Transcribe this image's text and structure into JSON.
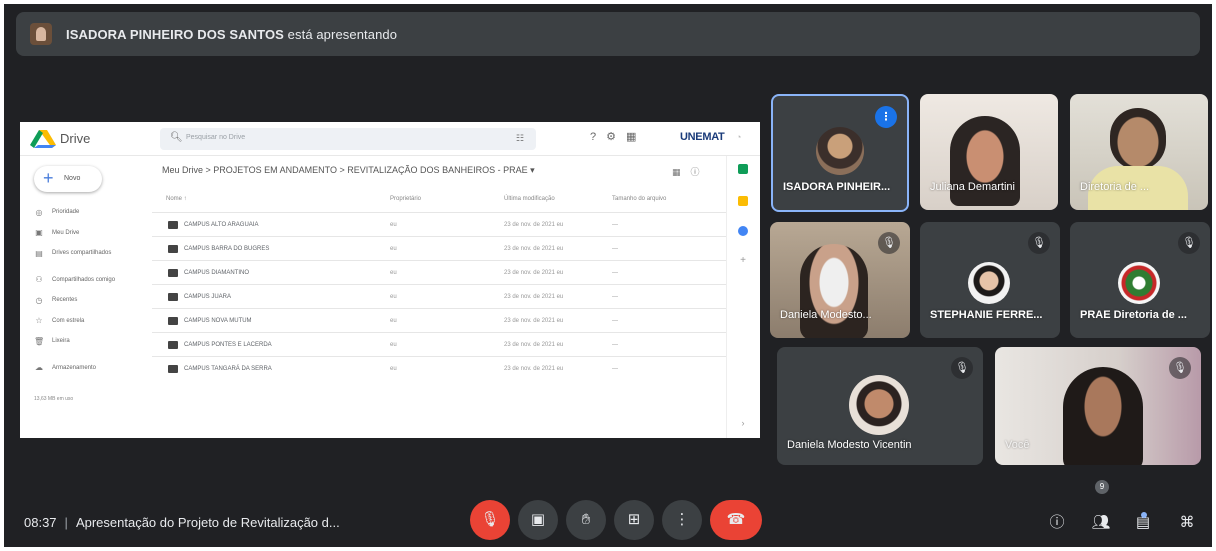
{
  "banner": {
    "presenter": "ISADORA PINHEIRO DOS SANTOS",
    "suffix": "está apresentando"
  },
  "drive": {
    "title": "Drive",
    "search_placeholder": "Pesquisar no Drive",
    "brand": "UNEMAT",
    "new_label": "Novo",
    "breadcrumb": "Meu Drive  >  PROJETOS EM ANDAMENTO  >  REVITALIZAÇÃO DOS BANHEIROS - PRAE  ▾",
    "nav": [
      {
        "icon": "◎",
        "label": "Prioridade"
      },
      {
        "icon": "▣",
        "label": "Meu Drive"
      },
      {
        "icon": "▤",
        "label": "Drives compartilhados"
      },
      {
        "icon": "⚇",
        "label": "Compartilhados comigo"
      },
      {
        "icon": "◷",
        "label": "Recentes"
      },
      {
        "icon": "☆",
        "label": "Com estrela"
      },
      {
        "icon": "🗑",
        "label": "Lixeira"
      },
      {
        "icon": "☁",
        "label": "Armazenamento"
      }
    ],
    "storage_used": "13,63 MB em uso",
    "columns": {
      "name": "Nome ↑",
      "owner": "Proprietário",
      "modified": "Última modificação",
      "size": "Tamanho do arquivo"
    },
    "files": [
      {
        "name": "CAMPUS ALTO ARAGUAIA",
        "owner": "eu",
        "modified": "23 de nov. de 2021 eu",
        "size": "—"
      },
      {
        "name": "CAMPUS BARRA DO BUGRES",
        "owner": "eu",
        "modified": "23 de nov. de 2021 eu",
        "size": "—"
      },
      {
        "name": "CAMPUS DIAMANTINO",
        "owner": "eu",
        "modified": "23 de nov. de 2021 eu",
        "size": "—"
      },
      {
        "name": "CAMPUS JUARA",
        "owner": "eu",
        "modified": "23 de nov. de 2021 eu",
        "size": "—"
      },
      {
        "name": "CAMPUS NOVA MUTUM",
        "owner": "eu",
        "modified": "23 de nov. de 2021 eu",
        "size": "—"
      },
      {
        "name": "CAMPUS PONTES E LACERDA",
        "owner": "eu",
        "modified": "23 de nov. de 2021 eu",
        "size": "—"
      },
      {
        "name": "CAMPUS TANGARÁ DA SERRA",
        "owner": "eu",
        "modified": "23 de nov. de 2021 eu",
        "size": "—"
      }
    ]
  },
  "participants": [
    {
      "name": "ISADORA PINHEIR...",
      "speaking": true
    },
    {
      "name": "Juliana Demartini",
      "muted": false
    },
    {
      "name": "Diretoria de ...",
      "muted": false
    },
    {
      "name": "Daniela Modesto...",
      "muted": true
    },
    {
      "name": "STEPHANIE FERRE...",
      "muted": true
    },
    {
      "name": "PRAE Diretoria de ...",
      "muted": true
    },
    {
      "name": "Daniela Modesto Vicentin",
      "muted": true
    },
    {
      "name": "Você",
      "muted": true
    }
  ],
  "bottom": {
    "time": "08:37",
    "separator": "|",
    "meeting_title": "Apresentação do Projeto de Revitalização d...",
    "people_count": "9"
  },
  "colors": {
    "background": "#202124",
    "tile": "#3c4043",
    "end_call": "#ea4335",
    "speaking_border": "#8ab4f8"
  }
}
